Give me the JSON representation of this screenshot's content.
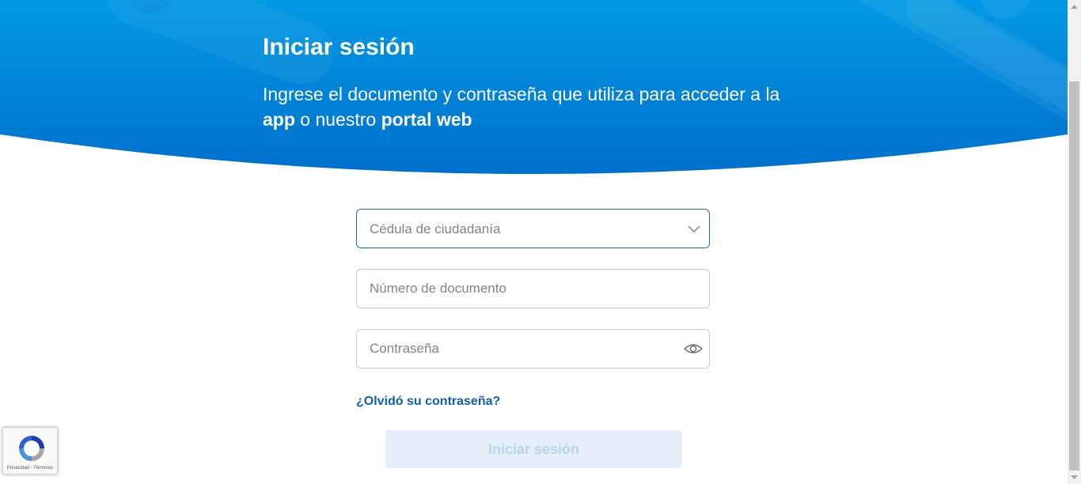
{
  "hero": {
    "title": "Iniciar sesión",
    "subtitle_part1": "Ingrese el documento y contraseña que utiliza para acceder a la ",
    "subtitle_bold1": "app",
    "subtitle_part2": " o nuestro ",
    "subtitle_bold2": "portal web"
  },
  "form": {
    "document_type": {
      "selected": "Cédula de ciudadanía",
      "icon": "chevron-down-icon"
    },
    "document_number": {
      "placeholder": "Número de documento",
      "value": ""
    },
    "password": {
      "placeholder": "Contraseña",
      "value": "",
      "icon": "eye-icon"
    },
    "forgot_password_label": "¿Olvidó su contraseña?",
    "submit_label": "Iniciar sesión"
  },
  "recaptcha": {
    "links": "Privacidad - Términos"
  },
  "colors": {
    "hero_blue": "#0078d4",
    "link_blue": "#1060a8",
    "button_disabled_bg": "#e4eff9",
    "button_disabled_text": "#b9d3ec",
    "focus_border": "#1c6fb5"
  }
}
